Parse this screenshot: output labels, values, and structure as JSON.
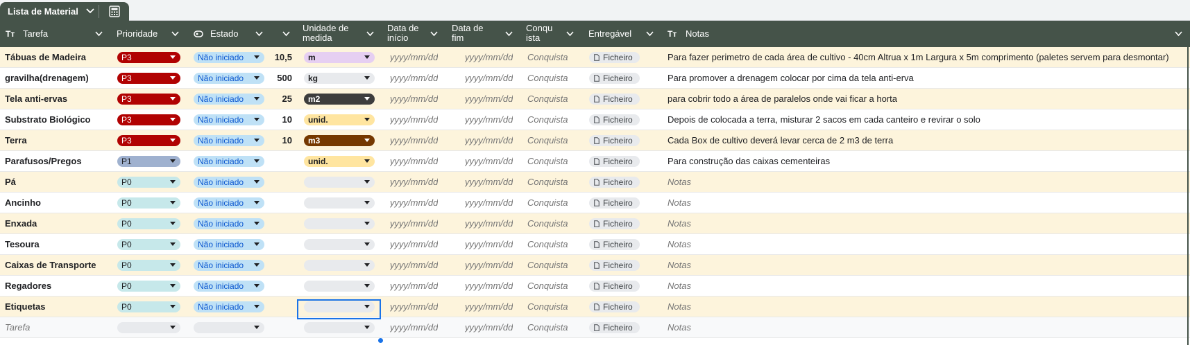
{
  "tab": {
    "label": "Lista de Material",
    "icon": "calculator-icon"
  },
  "columns": [
    {
      "label": "Tarefa",
      "icon": "text-type-icon"
    },
    {
      "label": "Prioridade"
    },
    {
      "label": "Estado",
      "icon": "status-icon"
    },
    {
      "label": ""
    },
    {
      "label": "Unidade de medida"
    },
    {
      "label": "Data de início"
    },
    {
      "label": "Data de fim"
    },
    {
      "label": "Conquista"
    },
    {
      "label": "Entregável"
    },
    {
      "label": "Notas",
      "icon": "text-type-icon"
    }
  ],
  "placeholders": {
    "date": "yyyy/mm/dd",
    "conquista": "Conquista",
    "file": "Ficheiro",
    "notes": "Notas",
    "task": "Tarefa"
  },
  "colors": {
    "header_bg": "#455349",
    "P3": {
      "bg": "#b10202",
      "fg": "#ffffff"
    },
    "P1": {
      "bg": "#9fb1cf",
      "fg": "#202124"
    },
    "P0": {
      "bg": "#c6e8ea",
      "fg": "#202124"
    },
    "status": {
      "bg": "#bfe1f6",
      "fg": "#0b57d0"
    },
    "m": {
      "bg": "#e6cff2",
      "fg": "#202124"
    },
    "kg": {
      "bg": "#e8eaed",
      "fg": "#202124"
    },
    "m2": {
      "bg": "#3d3d3d",
      "fg": "#ffffff"
    },
    "unid.": {
      "bg": "#ffe5a0",
      "fg": "#202124"
    },
    "m3": {
      "bg": "#753800",
      "fg": "#ffffff"
    },
    "empty": {
      "bg": "#e8eaed",
      "fg": "#202124"
    }
  },
  "rows": [
    {
      "task": "Tábuas de Madeira",
      "priority": "P3",
      "status": "Não iniciado",
      "qty": "10,5",
      "unit": "m",
      "notes": "Para fazer perimetro de cada área de cultivo - 40cm Altrua x 1m Largura x 5m comprimento (paletes servem para desmontar)"
    },
    {
      "task": "gravilha(drenagem)",
      "priority": "P3",
      "status": "Não iniciado",
      "qty": "500",
      "unit": "kg",
      "notes": "Para promover a drenagem colocar por cima da tela anti-erva"
    },
    {
      "task": "Tela anti-ervas",
      "priority": "P3",
      "status": "Não iniciado",
      "qty": "25",
      "unit": "m2",
      "notes": "para cobrir todo a área de paralelos onde vai ficar a horta"
    },
    {
      "task": "Substrato Biológico",
      "priority": "P3",
      "status": "Não iniciado",
      "qty": "10",
      "unit": "unid.",
      "notes": "Depois de colocada a terra, misturar 2 sacos em cada canteiro e revirar o solo"
    },
    {
      "task": "Terra",
      "priority": "P3",
      "status": "Não iniciado",
      "qty": "10",
      "unit": "m3",
      "notes": "Cada Box de cultivo deverá levar cerca de 2 m3 de terra"
    },
    {
      "task": "Parafusos/Pregos",
      "priority": "P1",
      "status": "Não iniciado",
      "qty": "",
      "unit": "unid.",
      "notes": "Para construção das caixas cementeiras"
    },
    {
      "task": "Pá",
      "priority": "P0",
      "status": "Não iniciado",
      "qty": "",
      "unit": "",
      "notes": ""
    },
    {
      "task": "Ancinho",
      "priority": "P0",
      "status": "Não iniciado",
      "qty": "",
      "unit": "",
      "notes": ""
    },
    {
      "task": "Enxada",
      "priority": "P0",
      "status": "Não iniciado",
      "qty": "",
      "unit": "",
      "notes": ""
    },
    {
      "task": "Tesoura",
      "priority": "P0",
      "status": "Não iniciado",
      "qty": "",
      "unit": "",
      "notes": ""
    },
    {
      "task": "Caixas de Transporte",
      "priority": "P0",
      "status": "Não iniciado",
      "qty": "",
      "unit": "",
      "notes": ""
    },
    {
      "task": "Regadores",
      "priority": "P0",
      "status": "Não iniciado",
      "qty": "",
      "unit": "",
      "notes": ""
    },
    {
      "task": "Etiquetas",
      "priority": "P0",
      "status": "Não iniciado",
      "qty": "",
      "unit": "",
      "notes": ""
    },
    {
      "task": "",
      "priority": "",
      "status": "",
      "qty": "",
      "unit": "",
      "notes": ""
    }
  ]
}
